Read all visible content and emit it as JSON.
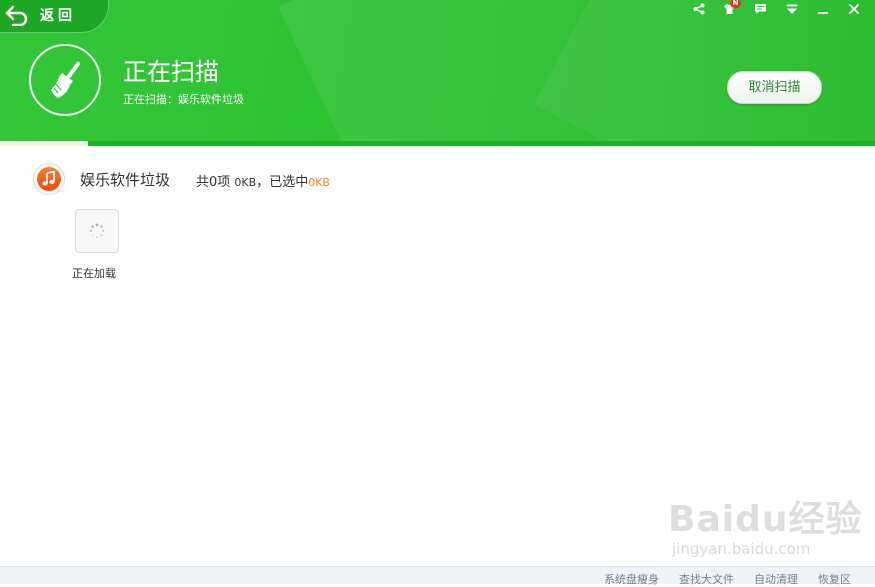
{
  "header": {
    "back_label": "返回",
    "scan_title": "正在扫描",
    "scan_subtitle": "正在扫描：娱乐软件垃圾",
    "cancel_label": "取消扫描",
    "badge_text": "N",
    "progress_fraction": 0.1
  },
  "window_controls": {
    "icons": [
      "share-icon",
      "shirt-skin-icon",
      "message-icon",
      "menu-dropdown-icon",
      "minimize-icon",
      "close-icon"
    ]
  },
  "category": {
    "name": "娱乐软件垃圾",
    "stats_prefix": "共0项",
    "stats_size": "0KB",
    "stats_mid": "，已选中",
    "stats_selected": "0KB",
    "icon": "music-note-icon",
    "accent_color": "#f08a1b"
  },
  "loader": {
    "label": "正在加载"
  },
  "footer": {
    "links": [
      "系统盘瘦身",
      "查找大文件",
      "自动清理",
      "恢复区"
    ]
  },
  "watermark": {
    "logo_text": "Baidu经验",
    "url": "jingyan.baidu.com"
  },
  "colors": {
    "header_green": "#2dc232",
    "progress_light": "#e9f7e4",
    "accent_orange": "#f08a1b"
  }
}
